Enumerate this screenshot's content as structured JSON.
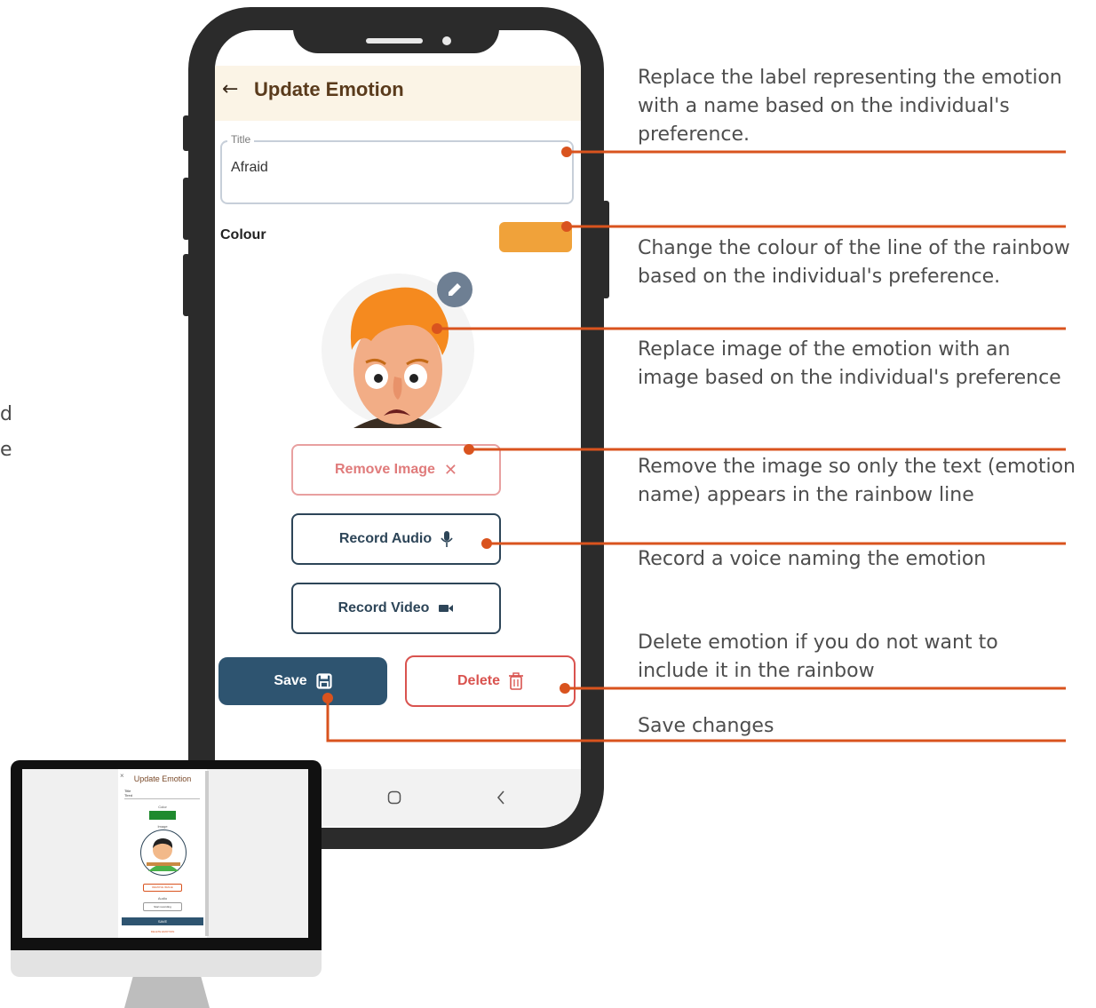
{
  "left_fragment": {
    "line1": "d",
    "line2": "e"
  },
  "phone": {
    "app_title": "Update Emotion",
    "back_icon": "arrow-left-icon",
    "title_field": {
      "legend": "Title",
      "value": "Afraid"
    },
    "colour_label": "Colour",
    "colour_value": "#f0a23a",
    "remove_image_label": "Remove Image",
    "record_audio_label": "Record Audio",
    "record_video_label": "Record Video",
    "save_label": "Save",
    "delete_label": "Delete",
    "icons": {
      "edit": "pencil-icon",
      "remove": "close-icon",
      "audio": "microphone-icon",
      "video": "video-camera-icon",
      "save": "floppy-disk-icon",
      "delete": "trash-icon",
      "home": "home-circle-icon",
      "back_nav": "chevron-left-icon"
    }
  },
  "annotations": {
    "rename": [
      "Replace the label representing the emotion",
      "with a name based on the individual's",
      "preference."
    ],
    "colour": [
      "Change the colour of the line of the rainbow",
      "based on the individual's preference."
    ],
    "image": [
      "Replace image of the emotion with an",
      "image based on the individual's preference"
    ],
    "remove": [
      "Remove the image so only the text (emotion",
      "name) appears in the rainbow line"
    ],
    "audio": [
      "Record a voice naming the emotion"
    ],
    "delete": [
      "Delete emotion if you do not want to",
      "include it in the rainbow"
    ],
    "save": [
      "Save changes"
    ]
  },
  "monitor": {
    "title": "Update Emotion",
    "title_label": "Title",
    "title_value": "Tired",
    "color_label": "Color",
    "color_value": "#1f8a2e",
    "image_label": "Image",
    "remove_label": "REMOVE IMAGE",
    "audio_label": "Audio",
    "audio_button": "Start recording",
    "save_label": "SAVE",
    "delete_label": "DELETE EMOTION"
  },
  "colors": {
    "accent_orange": "#d9531e",
    "navy": "#2e5470",
    "danger": "#d9534f"
  }
}
